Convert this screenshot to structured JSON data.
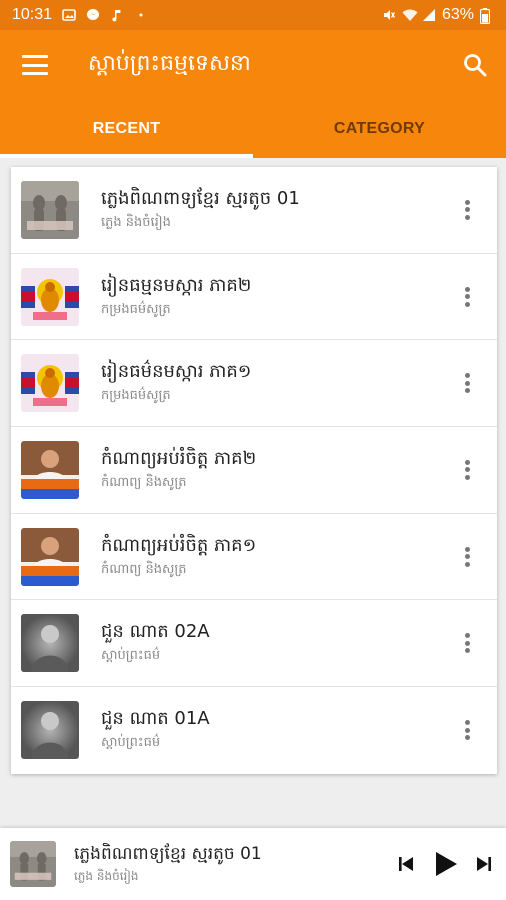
{
  "status_bar": {
    "time": "10:31",
    "battery": "63%"
  },
  "colors": {
    "primary": "#f7860d",
    "status_bar": "#e8790c"
  },
  "app_bar": {
    "title": "ស្តាប់ព្រះធម្មទេសនា",
    "menu_icon": "hamburger-menu-icon",
    "search_icon": "search-icon"
  },
  "tabs": [
    {
      "label": "RECENT",
      "active": true
    },
    {
      "label": "CATEGORY",
      "active": false
    }
  ],
  "recent_items": [
    {
      "title": "ភ្លេងពិណពាទ្យខ្មែរ ស្មរតូច 01",
      "subtitle": "ភ្លេង និងចំរៀង",
      "thumb": "apsara-relief"
    },
    {
      "title": "រៀនធម្មនមស្ការ ភាគ២",
      "subtitle": "កម្រងធម៌សូត្រ",
      "thumb": "buddha-poster"
    },
    {
      "title": "រៀនធម៌នមស្ការ ភាគ១",
      "subtitle": "កម្រងធម៌សូត្រ",
      "thumb": "buddha-poster"
    },
    {
      "title": "កំណាព្យអប់រំចិត្ត ភាគ២",
      "subtitle": "កំណាព្យ និងសូត្រ",
      "thumb": "poet-portrait"
    },
    {
      "title": "កំណាព្យអប់រំចិត្ត ភាគ១",
      "subtitle": "កំណាព្យ និងសូត្រ",
      "thumb": "poet-portrait"
    },
    {
      "title": "ជួន ណាត 02A",
      "subtitle": "ស្តាប់ព្រះធម៌",
      "thumb": "monk-photo"
    },
    {
      "title": "ជួន ណាត 01A",
      "subtitle": "ស្តាប់ព្រះធម៌",
      "thumb": "monk-photo"
    }
  ],
  "now_playing": {
    "title": "ភ្លេងពិណពាទ្យខ្មែរ ស្មរតូច 01",
    "subtitle": "ភ្លេង និងចំរៀង",
    "thumb": "apsara-relief"
  }
}
